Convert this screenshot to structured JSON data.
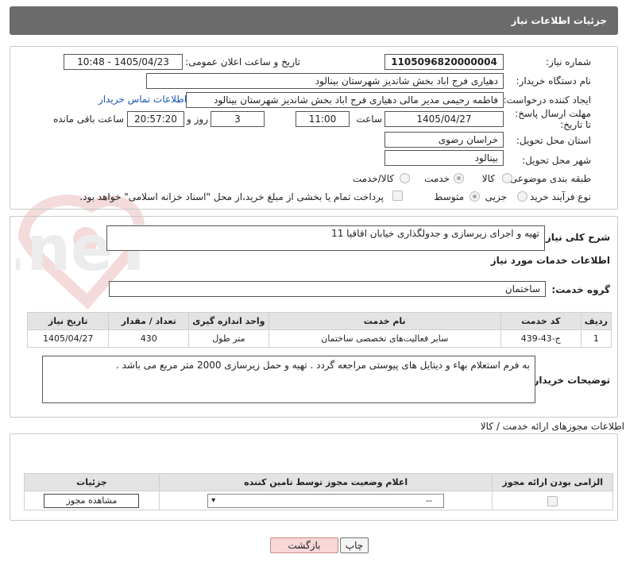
{
  "header": {
    "title": "جزئیات اطلاعات نیاز"
  },
  "watermark": {
    "text": "AriaTender.neT"
  },
  "info": {
    "need_number_label": "شماره نیاز:",
    "need_number": "1105096820000004",
    "announce_label": "تاریخ و ساعت اعلان عمومی:",
    "announce_value": "1405/04/23 - 10:48",
    "buyer_label": "نام دستگاه خریدار:",
    "buyer_value": "دهیاری فرج اباد بخش شاندیز شهرستان بینالود",
    "creator_label": "ایجاد کننده درخواست:",
    "creator_value": "فاطمه رحیمی مدیر مالی دهیاری فرج اباد بخش شاندیز شهرستان بینالود",
    "contact_link": "اطلاعات تماس خریدار",
    "deadline_label": "مهلت ارسال پاسخ: تا تاریخ:",
    "deadline_date": "1405/04/27",
    "time_label": "ساعت",
    "deadline_time": "11:00",
    "days_value": "3",
    "days_label": "روز و",
    "remaining_time": "20:57:20",
    "remaining_label": "ساعت باقی مانده",
    "province_label": "استان محل تحویل:",
    "province_value": "خراسان رضوی",
    "city_label": "شهر محل تحویل:",
    "city_value": "بینالود",
    "category_label": "طبقه بندی موضوعی:",
    "category_options": [
      "کالا",
      "خدمت",
      "کالا/خدمت"
    ],
    "category_selected": "خدمت",
    "process_label": "نوع فرآیند خرید :",
    "process_options": [
      "جزیی",
      "متوسط"
    ],
    "process_selected": "متوسط",
    "payment_note": "پرداخت تمام یا بخشی از مبلغ خرید،از محل \"اسناد خزانه اسلامی\" خواهد بود."
  },
  "summary": {
    "label": "شرح کلی نیاز:",
    "value": "تهیه و اجرای زیرسازی و جدولگذاری خیابان اقاقیا 11"
  },
  "services": {
    "section_title": "اطلاعات خدمات مورد نیاز",
    "group_label": "گروه خدمت:",
    "group_value": "ساختمان",
    "columns": [
      "ردیف",
      "کد خدمت",
      "نام خدمت",
      "واحد اندازه گیری",
      "تعداد / مقدار",
      "تاریخ نیاز"
    ],
    "rows": [
      {
        "row": "1",
        "code": "ج-43-439",
        "name": "سایر فعالیت‌های تخصصی ساختمان",
        "unit": "متر طول",
        "qty": "430",
        "date": "1405/04/27"
      }
    ]
  },
  "buyer_notes": {
    "label": "توضیحات خریدار:",
    "value": "به فرم استعلام بهاء و دیتایل های پیوستی مراجعه گردد . تهیه و حمل زیرسازی 2000 متر مربع می باشد ."
  },
  "permits": {
    "section_title": "اطلاعات مجوزهای ارائه خدمت / کالا",
    "columns": [
      "الزامی بودن ارائه مجوز",
      "اعلام وضعیت مجوز توسط تامین کننده",
      "جزئیات"
    ],
    "select_value": "--",
    "view_button": "مشاهده مجوز"
  },
  "footer": {
    "print_button": "چاپ",
    "back_button": "بازگشت"
  },
  "colors": {
    "header_bg": "#6b6b6b",
    "link": "#1a55b5",
    "back_button_bg": "#f8d7d7"
  }
}
